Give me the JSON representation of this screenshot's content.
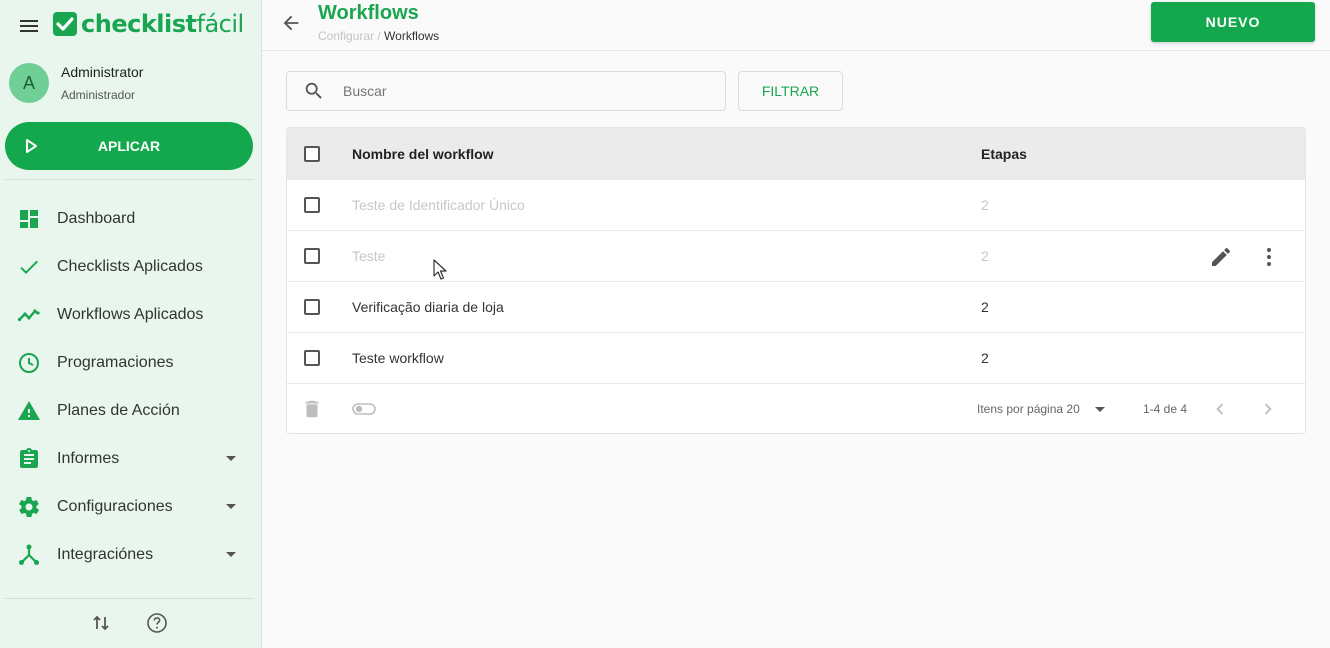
{
  "app": {
    "logo_text_bold": "checklist",
    "logo_text_light": "fácil",
    "brand_color": "#13a84d"
  },
  "user": {
    "initial": "A",
    "name": "Administrator",
    "role": "Administrador"
  },
  "sidebar": {
    "apply_label": "APLICAR",
    "items": [
      {
        "label": "Dashboard",
        "icon": "dashboard-icon"
      },
      {
        "label": "Checklists Aplicados",
        "icon": "check-icon"
      },
      {
        "label": "Workflows Aplicados",
        "icon": "trending-icon"
      },
      {
        "label": "Programaciones",
        "icon": "clock-icon"
      },
      {
        "label": "Planes de Acción",
        "icon": "warning-icon"
      },
      {
        "label": "Informes",
        "icon": "clipboard-icon"
      },
      {
        "label": "Configuraciones",
        "icon": "gear-icon"
      },
      {
        "label": "Integraciónes",
        "icon": "integration-icon"
      }
    ]
  },
  "header": {
    "title": "Workflows",
    "breadcrumb_parent": "Configurar",
    "breadcrumb_sep": " / ",
    "breadcrumb_current": "Workflows",
    "new_label": "NUEVO"
  },
  "toolbar": {
    "search_placeholder": "Buscar",
    "filter_label": "FILTRAR"
  },
  "table": {
    "col_name": "Nombre del workflow",
    "col_steps": "Etapas",
    "rows": [
      {
        "name": "Teste de Identificador Único",
        "steps": "2",
        "disabled": true
      },
      {
        "name": "Teste",
        "steps": "2",
        "disabled": true
      },
      {
        "name": "Verificação diaria de loja",
        "steps": "2",
        "disabled": false
      },
      {
        "name": "Teste workflow",
        "steps": "2",
        "disabled": false
      }
    ],
    "per_page_label": "Itens por página",
    "per_page_value": "20",
    "range_text": "1-4 de 4"
  }
}
